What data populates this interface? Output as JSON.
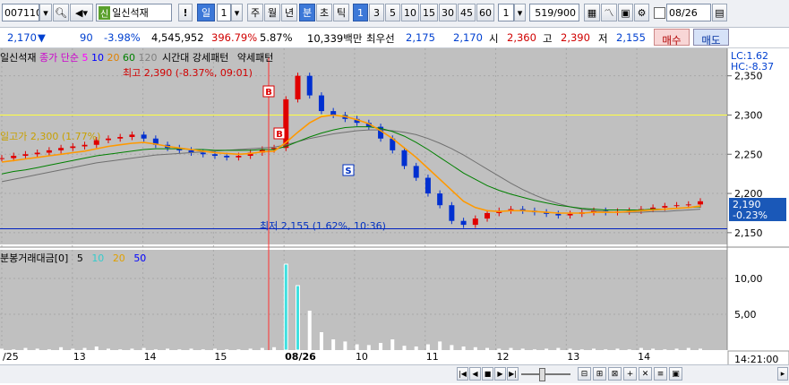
{
  "toolbar": {
    "code": "007110",
    "stock_badge": "신",
    "stock_name": "일신석재",
    "alert": "!",
    "period_day": "일",
    "period_num": "1",
    "period_week": "주",
    "period_month": "월",
    "period_year": "년",
    "period_minute": "분",
    "period_second": "초",
    "period_tick": "틱",
    "minute_options": [
      "1",
      "3",
      "5",
      "10",
      "15",
      "30",
      "45",
      "60"
    ],
    "selected_minute": "1",
    "count_value": "1",
    "range_value": "519",
    "range_total": "/900",
    "date_value": "08/26"
  },
  "info": {
    "price": "2,170",
    "change_arrow": "▼",
    "change": "90",
    "change_pct": "-3.98%",
    "volume": "4,545,952",
    "volume_ratio": "396.79%",
    "turnover": "5.87%",
    "trade_amount": "10,339백만",
    "best_ask_label": "최우선",
    "best_ask": "2,175",
    "best_bid": "2,170",
    "open_label": "시",
    "open": "2,360",
    "high_label": "고",
    "high": "2,390",
    "low_label": "저",
    "low": "2,155",
    "buy_button": "매수",
    "sell_button": "매도"
  },
  "chart": {
    "legend_name": "일신석재",
    "legend_price_type": "종가",
    "legend_ma_type": "단순",
    "ma_periods": [
      "5",
      "10",
      "20",
      "60",
      "120"
    ],
    "ma_colors": [
      "#ff00ff",
      "#0000ff",
      "#ffa500",
      "#008000",
      "#808080"
    ],
    "legend_time_label": "시간대",
    "legend_strong": "강세패턴",
    "legend_weak": "약세패턴",
    "lc_label": "LC:1.62",
    "hc_label": "HC:-8.37",
    "high_annotation": "최고 2,390 (-8.37%, 09:01)",
    "prev_close_annotation": "일고가 2,300 (1.77%)",
    "low_annotation": "최저 2,155 (1.62%, 10:36)",
    "current_price_tag": "2,190",
    "current_pct_tag": "-0.23%",
    "volume_legend_name": "분봉거래대금[0]",
    "volume_ma_periods": [
      "5",
      "10",
      "20",
      "50"
    ],
    "volume_ma_colors": [
      "#000000",
      "#33cccc",
      "#ffa500",
      "#0000ff"
    ],
    "time_label": "14:21:00",
    "signal_buy": "B",
    "signal_sell": "S"
  },
  "chart_data": {
    "type": "line",
    "price_axis": {
      "ticks": [
        "2,350",
        "2,300",
        "2,250",
        "2,200",
        "2,150"
      ],
      "values": [
        2350,
        2300,
        2250,
        2200,
        2150
      ],
      "range": [
        2135,
        2385
      ]
    },
    "volume_axis": {
      "ticks": [
        "10,00",
        "5,00"
      ],
      "values": [
        10,
        5
      ],
      "range": [
        0,
        14
      ]
    },
    "x_ticks": [
      "/25",
      "13",
      "14",
      "15",
      "08/26",
      "10",
      "11",
      "12",
      "13",
      "14"
    ],
    "reference_lines": {
      "high": 2390,
      "prev_high": 2300,
      "low": 2155
    },
    "price_series": [
      2245,
      2248,
      2250,
      2252,
      2255,
      2258,
      2260,
      2262,
      2268,
      2270,
      2272,
      2275,
      2270,
      2262,
      2258,
      2255,
      2252,
      2250,
      2248,
      2246,
      2248,
      2252,
      2256,
      2258,
      2320,
      2350,
      2325,
      2305,
      2300,
      2295,
      2290,
      2285,
      2270,
      2255,
      2235,
      2220,
      2200,
      2185,
      2165,
      2160,
      2168,
      2175,
      2178,
      2180,
      2178,
      2176,
      2174,
      2172,
      2174,
      2176,
      2178,
      2176,
      2177,
      2178,
      2180,
      2182,
      2184,
      2185,
      2186,
      2190
    ],
    "ma20_series": [
      2240,
      2242,
      2244,
      2246,
      2248,
      2250,
      2252,
      2254,
      2257,
      2260,
      2262,
      2264,
      2265,
      2263,
      2260,
      2258,
      2256,
      2254,
      2252,
      2251,
      2250,
      2251,
      2253,
      2254,
      2265,
      2278,
      2290,
      2298,
      2300,
      2298,
      2294,
      2289,
      2280,
      2270,
      2258,
      2246,
      2232,
      2218,
      2204,
      2190,
      2182,
      2178,
      2177,
      2178,
      2178,
      2177,
      2176,
      2175,
      2175,
      2175,
      2176,
      2176,
      2176,
      2177,
      2178,
      2179,
      2180,
      2181,
      2182,
      2184
    ],
    "ma60_series": [
      2225,
      2228,
      2230,
      2233,
      2236,
      2239,
      2242,
      2245,
      2248,
      2250,
      2252,
      2254,
      2256,
      2257,
      2257,
      2257,
      2256,
      2256,
      2255,
      2255,
      2255,
      2255,
      2256,
      2256,
      2260,
      2266,
      2272,
      2277,
      2281,
      2284,
      2285,
      2285,
      2283,
      2279,
      2273,
      2265,
      2256,
      2246,
      2236,
      2226,
      2218,
      2210,
      2204,
      2199,
      2195,
      2191,
      2188,
      2185,
      2183,
      2181,
      2180,
      2179,
      2179,
      2179,
      2179,
      2180,
      2180,
      2181,
      2182,
      2183
    ],
    "ma120_series": [
      2215,
      2218,
      2221,
      2224,
      2227,
      2230,
      2233,
      2236,
      2239,
      2241,
      2243,
      2245,
      2247,
      2249,
      2250,
      2251,
      2252,
      2253,
      2254,
      2255,
      2256,
      2257,
      2258,
      2259,
      2262,
      2266,
      2270,
      2273,
      2276,
      2278,
      2280,
      2281,
      2281,
      2280,
      2278,
      2275,
      2270,
      2264,
      2257,
      2249,
      2240,
      2231,
      2222,
      2213,
      2205,
      2198,
      2192,
      2187,
      2183,
      2180,
      2178,
      2177,
      2176,
      2176,
      2176,
      2177,
      2177,
      2178,
      2179,
      2180
    ],
    "volume_series": [
      0.2,
      0.1,
      0.3,
      0.2,
      0.1,
      0.4,
      0.2,
      0.3,
      0.5,
      0.2,
      0.1,
      0.2,
      0.3,
      0.1,
      0.2,
      0.1,
      0.2,
      0.1,
      0.2,
      0.1,
      0.1,
      0.2,
      0.3,
      0.4,
      12,
      9,
      5.5,
      2.5,
      1.5,
      1.2,
      0.8,
      0.7,
      1.0,
      1.5,
      0.6,
      0.5,
      0.8,
      1.2,
      0.7,
      0.5,
      0.4,
      0.3,
      0.2,
      0.3,
      0.2,
      0.1,
      0.2,
      0.3,
      0.2,
      0.1,
      0.2,
      0.1,
      0.2,
      0.1,
      0.3,
      0.2,
      0.1,
      0.2,
      0.3,
      0.2
    ]
  },
  "bottom_bar": {
    "nav_buttons": [
      "|◀",
      "◀",
      "■",
      "▶",
      "▶|"
    ],
    "tool_icons": [
      "⊟",
      "⊞",
      "⊠",
      "+",
      "✕",
      "≡",
      "▣"
    ],
    "more_button": "▸"
  }
}
